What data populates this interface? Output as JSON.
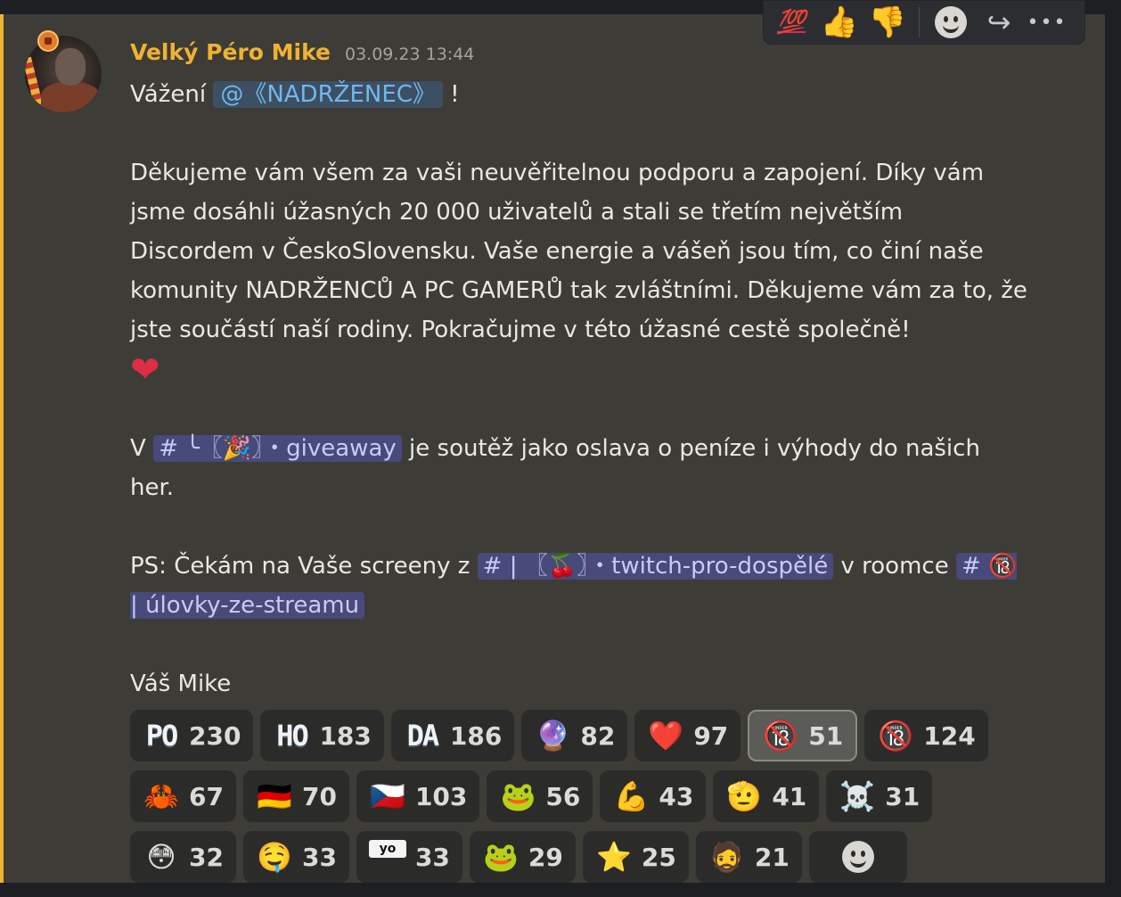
{
  "message": {
    "username": "Velký Péro Mike",
    "timestamp": "03.09.23 13:44",
    "greeting_prefix": "Vážení",
    "mention": "@《NADRŽENEC》",
    "greeting_suffix": "!",
    "paragraph1": "Děkujeme vám všem za vaši neuvěřitelnou podporu a zapojení. Díky vám jsme dosáhli úžasných 20 000 uživatelů a stali se třetím největším Discordem v ČeskoSlovensku. Vaše energie a vášeň jsou tím, co činí naše komunity NADRŽENCŮ A PC GAMERŮ tak zvláštními. Děkujeme vám za to, že jste součástí naší rodiny. Pokračujme v této úžasné cestě společně!",
    "heart": "❤",
    "p2_prefix": "V",
    "channel_giveaway": "# ╰〖🎉〗・giveaway",
    "p2_suffix": "je soutěž jako oslava o peníze i výhody do našich her.",
    "p3_prefix": "PS: Čekám na Vaše screeny z",
    "channel_twitch": "# | 〖🍒〗・twitch-pro-dospělé",
    "p3_middle": "v roomce",
    "channel_ulovky": "# 🔞 | úlovky-ze-streamu",
    "signature": "Váš Mike"
  },
  "reactions": [
    [
      {
        "emoji": "PO",
        "type": "text",
        "count": "230",
        "active": false
      },
      {
        "emoji": "HO",
        "type": "text",
        "count": "183",
        "active": false
      },
      {
        "emoji": "DA",
        "type": "text",
        "count": "186",
        "active": false
      },
      {
        "emoji": "🔮",
        "type": "glyph",
        "count": "82",
        "active": false
      },
      {
        "emoji": "❤️",
        "type": "glyph",
        "count": "97",
        "active": false
      },
      {
        "emoji": "🔞",
        "type": "glyph",
        "count": "51",
        "active": true
      },
      {
        "emoji": "🔞",
        "type": "glyph",
        "count": "124",
        "active": false
      }
    ],
    [
      {
        "emoji": "🦀",
        "type": "glyph",
        "count": "67",
        "active": false
      },
      {
        "emoji": "🇩🇪",
        "type": "glyph",
        "count": "70",
        "active": false
      },
      {
        "emoji": "🇨🇿",
        "type": "glyph",
        "count": "103",
        "active": false
      },
      {
        "emoji": "🐸",
        "type": "glyph",
        "count": "56",
        "active": false
      },
      {
        "emoji": "💪",
        "type": "glyph",
        "count": "43",
        "active": false
      },
      {
        "emoji": "🫡",
        "type": "glyph",
        "count": "41",
        "active": false
      },
      {
        "emoji": "☠️",
        "type": "glyph",
        "count": "31",
        "active": false
      }
    ],
    [
      {
        "emoji": "😳",
        "type": "glyph",
        "count": "32",
        "active": false
      },
      {
        "emoji": "🤤",
        "type": "glyph",
        "count": "33",
        "active": false
      },
      {
        "emoji": "yo",
        "type": "glyph",
        "count": "33",
        "active": false
      },
      {
        "emoji": "🐸",
        "type": "glyph",
        "count": "29",
        "active": false
      },
      {
        "emoji": "⭐",
        "type": "glyph",
        "count": "25",
        "active": false
      },
      {
        "emoji": "🧔",
        "type": "glyph",
        "count": "21",
        "active": false
      }
    ]
  ],
  "toolbar": {
    "hundred": "💯",
    "thumbs_up": "👍",
    "thumbs_down": "👎",
    "forward": "↪",
    "more": "•••"
  },
  "icons": {
    "add_reaction": "smiley-icon",
    "forward": "forward-arrow-icon",
    "more": "more-dots-icon"
  },
  "colors": {
    "username": "#f0b232",
    "mention_bg": "#3d4f63",
    "channel_bg": "#474a7a",
    "highlight_bar": "#f0b232"
  }
}
